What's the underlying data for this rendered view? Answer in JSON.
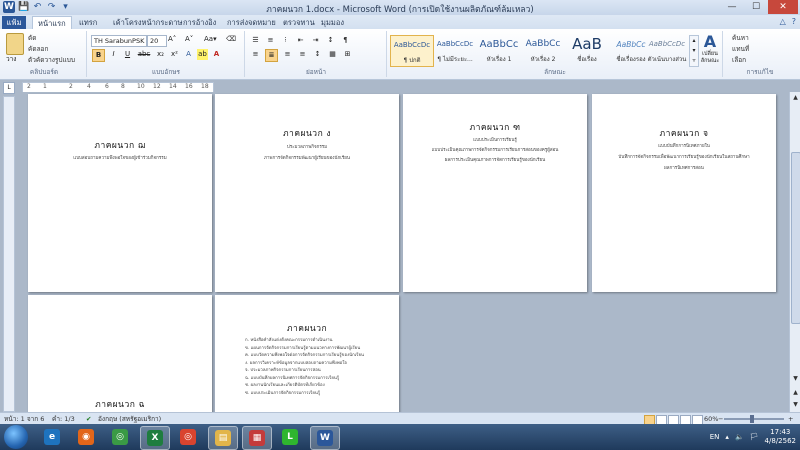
{
  "titlebar": {
    "title": "ภาคผนวก 1.docx - Microsoft Word (การเปิดใช้งานผลิตภัณฑ์ล้มเหลว)",
    "qat_icons": [
      "word-icon",
      "save-icon",
      "undo-icon",
      "redo-icon",
      "customize-icon"
    ],
    "qat_glyphs": [
      "W",
      "💾",
      "↶",
      "↷",
      "▾"
    ],
    "min_glyph": "—",
    "max_glyph": "☐",
    "close_glyph": "✕"
  },
  "tabs": {
    "file": "แฟ้ม",
    "home": "หน้าแรก",
    "insert": "แทรก",
    "page_layout": "เค้าโครงหน้ากระดาษ",
    "references": "การอ้างอิง",
    "mailings": "การส่งจดหมาย",
    "review": "ตรวจทาน",
    "view": "มุมมอง",
    "right_icons": [
      "△",
      "?"
    ]
  },
  "ribbon": {
    "clipboard": {
      "paste": "วาง",
      "cut": "ตัด",
      "copy": "คัดลอก",
      "format_painter": "ตัวคัดวางรูปแบบ",
      "group": "คลิปบอร์ด"
    },
    "font": {
      "font_name": "TH SarabunPSK",
      "font_size": "20",
      "grow": "A˄",
      "shrink": "A˅",
      "case": "Aa▾",
      "clear": "⌫",
      "bold": "B",
      "italic": "I",
      "underline": "U",
      "strike": "abc",
      "sub": "x₂",
      "sup": "x²",
      "effects": "A",
      "highlight": "ab",
      "color": "A",
      "group": "แบบอักษร"
    },
    "paragraph": {
      "row1": [
        "☰",
        "≡",
        "⁝",
        "⇤",
        "⇥",
        "↕",
        "¶"
      ],
      "row2": [
        "≡",
        "≣",
        "≡",
        "≡",
        "↕",
        "▦",
        "⊞"
      ],
      "group": "ย่อหน้า"
    },
    "styles": {
      "items": [
        {
          "sample": "AaBbCcDc",
          "name": "¶ ปกติ"
        },
        {
          "sample": "AaBbCcDc",
          "name": "¶ ไม่มีระยะ..."
        },
        {
          "sample": "AaBbCc",
          "name": "หัวเรื่อง 1"
        },
        {
          "sample": "AaBbCc",
          "name": "หัวเรื่อง 2"
        },
        {
          "sample": "AaB",
          "name": "ชื่อเรื่อง"
        },
        {
          "sample": "AaBbCc",
          "name": "ชื่อเรื่องรอง"
        },
        {
          "sample": "AaBbCcDc",
          "name": "ตัวเน้นบางส่วน"
        }
      ],
      "scroll_glyphs": [
        "▴",
        "▾",
        "▿"
      ],
      "change_styles": "เปลี่ยน\nลักษณะ",
      "change_glyph": "A",
      "group": "ลักษณะ"
    },
    "editing": {
      "find": "ค้นหา",
      "replace": "แทนที่",
      "select": "เลือก",
      "group": "การแก้ไข"
    }
  },
  "ruler": {
    "corner_glyph": "L",
    "ticks": [
      "2",
      "1",
      "2",
      "4",
      "6",
      "8",
      "10",
      "12",
      "14",
      "16",
      "18"
    ]
  },
  "pages": [
    {
      "title": "ภาคผนวก ฌ",
      "lines": [
        "แบบสอบถามความพึงพอใจของผู้เข้าร่วมกิจกรรม"
      ],
      "list": []
    },
    {
      "title": "ภาคผนวก ง",
      "lines": [
        "ประมวลภาพกิจกรรม",
        "ภาพการจัดกิจกรรมพัฒนาผู้เรียนของนักเรียน"
      ],
      "list": []
    },
    {
      "title": "ภาคผนวก ฑ",
      "lines": [
        "แบบประเมินการเรียนรู้",
        "แบบประเมินคุณภาพการจัดกิจกรรมการเรียนการสอนของครูผู้สอน",
        "ผลการประเมินคุณภาพการจัดการเรียนรู้ของนักเรียน"
      ],
      "list": []
    },
    {
      "title": "ภาคผนวก จ",
      "lines": [
        "แบบบันทึกการนิเทศภายใน",
        "บันทึกการจัดกิจกรรมเพื่อพัฒนาการเรียนรู้ของนักเรียนในสถานศึกษา",
        "ผลการนิเทศการสอน"
      ],
      "list": []
    },
    {
      "title": "ภาคผนวก ฉ",
      "lines": [],
      "list": []
    },
    {
      "title": "ภาคผนวก",
      "lines": [],
      "list": [
        "ก. หนังสือคำสั่งแต่งตั้งคณะกรรมการดำเนินงาน",
        "ข. แผนการจัดกิจกรรมการเรียนรู้ตามแนวทางการพัฒนาผู้เรียน",
        "ค. แบบวัดความพึงพอใจต่อการจัดกิจกรรมการเรียนรู้ของนักเรียน",
        "ง. ผลการวิเคราะห์ข้อมูลจากแบบสอบถามความพึงพอใจ",
        "จ. ประมวลภาพกิจกรรมการเรียนการสอน",
        "ฉ. แบบบันทึกผลการนิเทศการจัดกิจกรรมการเรียนรู้",
        "ช. ผลงานนักเรียนและเกียรติบัตรที่เกี่ยวข้อง",
        "ซ. แบบประเมินการจัดกิจกรรมการเรียนรู้"
      ]
    }
  ],
  "vscroll": {
    "up": "▲",
    "down": "▼",
    "prev": "▲",
    "next": "▼"
  },
  "status": {
    "page": "หน้า: 1 จาก 6",
    "words": "คำ: 1/3",
    "lang": "อังกฤษ (สหรัฐอเมริกา)",
    "zoom": "60%",
    "zoom_minus": "−",
    "zoom_plus": "+"
  },
  "taskbar": {
    "apps": [
      {
        "icon": "ie-icon",
        "glyph": "e",
        "color": "#1e73be"
      },
      {
        "icon": "firefox-icon",
        "glyph": "◉",
        "color": "#e2661a"
      },
      {
        "icon": "chrome-icon",
        "glyph": "◎",
        "color": "#3a9a45"
      },
      {
        "icon": "excel-icon",
        "glyph": "X",
        "color": "#1f7d3f"
      },
      {
        "icon": "chrome-alt-icon",
        "glyph": "◎",
        "color": "#d9442f"
      },
      {
        "icon": "folder-icon",
        "glyph": "▤",
        "color": "#e2b54a"
      },
      {
        "icon": "calendar-icon",
        "glyph": "▦",
        "color": "#c43b3b"
      },
      {
        "icon": "line-icon",
        "glyph": "L",
        "color": "#2fb52f"
      },
      {
        "icon": "word-icon",
        "glyph": "W",
        "color": "#2b579a"
      }
    ],
    "lang": "EN",
    "tray_icons": [
      "▴",
      "🔈",
      "🏳"
    ],
    "time": "17:43",
    "date": "4/8/2562"
  }
}
